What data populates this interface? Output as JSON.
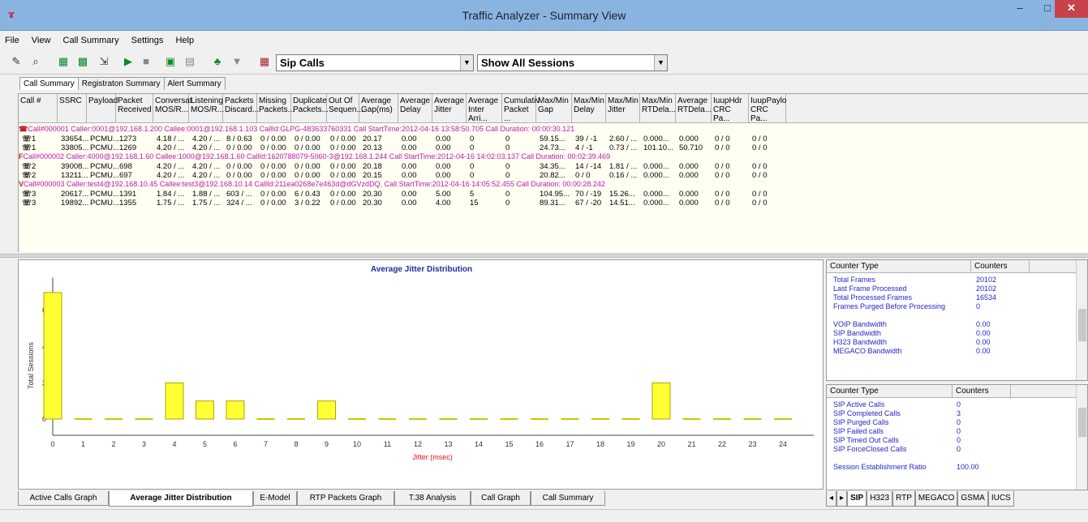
{
  "window": {
    "title": "Traffic Analyzer - Summary View",
    "min": "–",
    "max": "□",
    "close": "✕"
  },
  "menu": [
    "File",
    "View",
    "Call Summary",
    "Settings",
    "Help"
  ],
  "toolbar": {
    "filter_value": "Sip Calls",
    "session_value": "Show All Sessions"
  },
  "top_tabs": [
    "Call Summary",
    "Registraton Summary",
    "Alert Summary"
  ],
  "columns": [
    "Call #",
    "SSRC",
    "Payload",
    "Packet Received",
    "Conversat MOS/R...",
    "Listening MOS/R...",
    "Packets Discard...",
    "Missing Packets...",
    "Duplicate Packets...",
    "Out Of Sequen...",
    "Average Gap(ms)",
    "Average Delay",
    "Average Jitter",
    "Average Inter Arri...",
    "Cumulativ Packet ...",
    "Max/Min Gap",
    "Max/Min Delay",
    "Max/Min Jitter",
    "Max/Min RTDela...",
    "Average RTDela...",
    "IuupHdr CRC Pa...",
    "IuupPaylo CRC Pa..."
  ],
  "calls": [
    {
      "icon": "☎",
      "header": "Call#000001  Caller:0001@192.168.1.200 Callee:0001@192.168.1.103 CallId:GLPG-483633760331 Call StartTime:2012-04-16 13:58:50.705 Call Duration: 00:00:30.121",
      "rows": [
        [
          "1",
          "33654...",
          "PCMU...",
          "1273",
          "4.18 / ...",
          "4.20 / ...",
          "8 / 0.63",
          "0 / 0.00",
          "0 / 0.00",
          "0 / 0.00",
          "20.17",
          "0.00",
          "0.00",
          "0",
          "0",
          "59.15...",
          "39 / -1",
          "2.60 / ...",
          "0.000...",
          "0.000",
          "0 / 0",
          "0 / 0"
        ],
        [
          "1",
          "33805...",
          "PCMU...",
          "1269",
          "4.20 / ...",
          "4.20 / ...",
          "0 / 0.00",
          "0 / 0.00",
          "0 / 0.00",
          "0 / 0.00",
          "20.13",
          "0.00",
          "0.00",
          "0",
          "0",
          "24.73...",
          "4 / -1",
          "0.73 / ...",
          "101.10...",
          "50.710",
          "0 / 0",
          "0 / 0"
        ]
      ]
    },
    {
      "icon": "F",
      "header": "Call#000002  Caller:4000@192.168.1.60 Callee:1000@192.168.1.60 CallId:1620788079-5060-3@192.168.1.244 Call StartTime:2012-04-16 14:02:03.137 Call Duration: 00:02:39.469",
      "rows": [
        [
          "2",
          "39008...",
          "PCMU...",
          "698",
          "4.20 / ...",
          "4.20 / ...",
          "0 / 0.00",
          "0 / 0.00",
          "0 / 0.00",
          "0 / 0.00",
          "20.18",
          "0.00",
          "0.00",
          "0",
          "0",
          "34.35...",
          "14 / -14",
          "1.81 / ...",
          "0.000...",
          "0.000",
          "0 / 0",
          "0 / 0"
        ],
        [
          "2",
          "13211...",
          "PCMU...",
          "697",
          "4.20 / ...",
          "4.20 / ...",
          "0 / 0.00",
          "0 / 0.00",
          "0 / 0.00",
          "0 / 0.00",
          "20.15",
          "0.00",
          "0.00",
          "0",
          "0",
          "20.82...",
          "0 / 0",
          "0.16 / ...",
          "0.000...",
          "0.000",
          "0 / 0",
          "0 / 0"
        ]
      ]
    },
    {
      "icon": "V",
      "header": "Call#000003  Caller:test4@192.168.10.45 Callee:test3@192.168.10.14 CallId:211ea0268e7e463d@dGVzdDQ. Call StartTime:2012-04-16 14:05:52.455 Call Duration: 00:00:28.242",
      "rows": [
        [
          "3",
          "20617...",
          "PCMU...",
          "1391",
          "1.84 / ...",
          "1.88 / ...",
          "603 / ...",
          "0 / 0.00",
          "6 / 0.43",
          "0 / 0.00",
          "20.30",
          "0.00",
          "5.00",
          "5",
          "0",
          "104.95...",
          "70 / -19",
          "15.26...",
          "0.000...",
          "0.000",
          "0 / 0",
          "0 / 0"
        ],
        [
          "3",
          "19892...",
          "PCMU...",
          "1355",
          "1.75 / ...",
          "1.75 / ...",
          "324 / ...",
          "0 / 0.00",
          "3 / 0.22",
          "0 / 0.00",
          "20.30",
          "0.00",
          "4.00",
          "15",
          "0",
          "89.31...",
          "67 / -20",
          "14.51...",
          "0.000...",
          "0.000",
          "0 / 0",
          "0 / 0"
        ]
      ]
    }
  ],
  "chart_data": {
    "type": "bar",
    "title": "Average Jitter Distribution",
    "xlabel": "Jitter (msec)",
    "ylabel": "Total Sessions",
    "categories": [
      0,
      1,
      2,
      3,
      4,
      5,
      6,
      7,
      8,
      9,
      10,
      11,
      12,
      13,
      14,
      15,
      16,
      17,
      18,
      19,
      20,
      21,
      22,
      23,
      24
    ],
    "values": [
      7,
      0,
      0,
      0,
      2,
      1,
      1,
      0,
      0,
      1,
      0,
      0,
      0,
      0,
      0,
      0,
      0,
      0,
      0,
      0,
      2,
      0,
      0,
      0,
      0
    ],
    "ylim": [
      -1,
      8
    ],
    "yticks": [
      0,
      2,
      4,
      6
    ],
    "bar_color": "#ffff33"
  },
  "bottom_tabs": [
    "Active Calls Graph",
    "Average Jitter Distribution",
    "E-Model",
    "RTP Packets Graph",
    "T.38 Analysis",
    "Call Graph",
    "Call Summary"
  ],
  "counters_top": {
    "headers": [
      "Counter Type",
      "Counters"
    ],
    "rows": [
      [
        "Total Frames",
        "20102"
      ],
      [
        "Last Frame Processed",
        "20102"
      ],
      [
        "Total Processed Frames",
        "16534"
      ],
      [
        "Frames Purged Before Processing",
        "0"
      ],
      [
        "",
        ""
      ],
      [
        "VOIP Bandwidth",
        "0.00"
      ],
      [
        "SIP Bandwidth",
        "0.00"
      ],
      [
        "H323 Bandwidth",
        "0.00"
      ],
      [
        "MEGACO Bandwidth",
        "0.00"
      ]
    ]
  },
  "counters_bottom": {
    "headers": [
      "Counter Type",
      "Counters"
    ],
    "rows": [
      [
        "SIP Active Calls",
        "0"
      ],
      [
        "SIP Completed Calls",
        "3"
      ],
      [
        "SIP Purged Calls",
        "0"
      ],
      [
        "SIP Failed calls",
        "0"
      ],
      [
        "SIP Timed Out Calls",
        "0"
      ],
      [
        "SIP ForceClosed Calls",
        "0"
      ],
      [
        "",
        ""
      ],
      [
        "Session Establishment Ratio",
        "100.00"
      ]
    ]
  },
  "right_tabs": [
    "SIP",
    "H323",
    "RTP",
    "MEGACO",
    "GSMA",
    "IUCS"
  ]
}
